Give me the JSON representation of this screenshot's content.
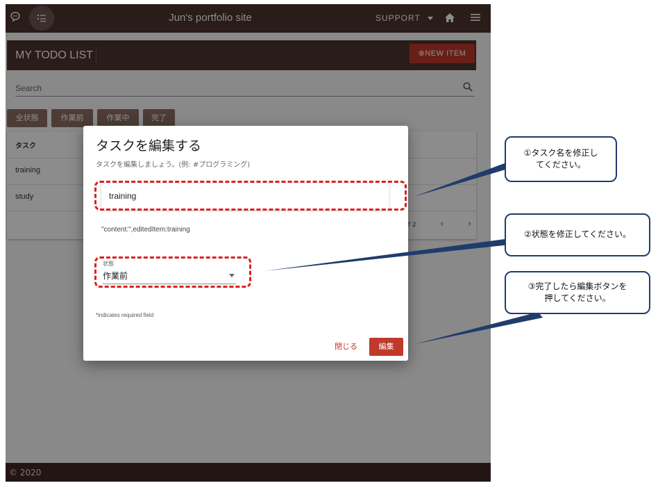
{
  "topbar": {
    "title": "Jun's portfolio site",
    "support_label": "SUPPORT",
    "icons": [
      "chat-icon",
      "checklist-icon",
      "home-icon",
      "menu-icon"
    ]
  },
  "todo": {
    "header": "MY TODO LIST",
    "new_item_label": "⊕NEW ITEM",
    "search_placeholder": "Search",
    "filters": [
      "全状態",
      "作業前",
      "作業中",
      "完了"
    ],
    "column_header": "タスク",
    "rows": [
      "training",
      "study"
    ],
    "pagination": "f 2"
  },
  "footer": {
    "copyright": "© 2020"
  },
  "dialog": {
    "title": "タスクを編集する",
    "subtitle": "タスクを編集しましょう。(例: #プログラミング)",
    "task_value": "training",
    "debug_text": "\"content:\",editedItem:training",
    "status_label": "状態",
    "status_value": "作業前",
    "required_note": "*indicates required field",
    "close_label": "閉じる",
    "edit_label": "編集"
  },
  "callouts": {
    "c1": "①タスク名を修正し\nてください。",
    "c2": "②状態を修正してください。",
    "c3": "③完了したら編集ボタンを\n押してください。"
  },
  "colors": {
    "brand": "#4e342e",
    "accent": "#c0392b",
    "chip": "#8d6e63",
    "callout_border": "#1f3c6b",
    "dash": "#e01e1e"
  }
}
